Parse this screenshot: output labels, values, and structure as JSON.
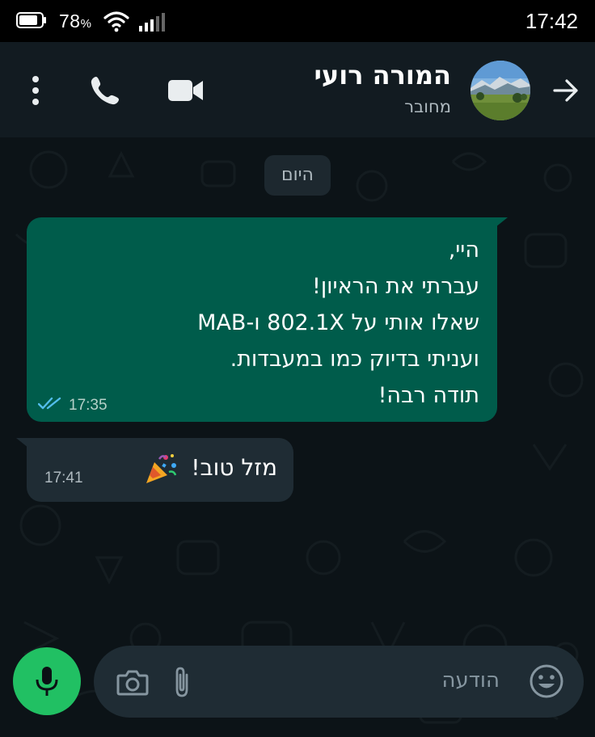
{
  "status_bar": {
    "battery_percent": "78",
    "battery_unit": "%",
    "time": "17:42"
  },
  "header": {
    "contact_name": "המורה רועי",
    "status": "מחובר"
  },
  "chat": {
    "date_chip": "היום",
    "messages": [
      {
        "direction": "outgoing",
        "text": "היי,\nעברתי את הראיון!\nשאלו אותי על 802.1X ו-MAB\nועניתי בדיוק כמו במעבדות.\nתודה רבה!",
        "time": "17:35",
        "status": "read"
      },
      {
        "direction": "incoming",
        "text": "מזל טוב!",
        "emoji": "party-popper",
        "time": "17:41"
      }
    ]
  },
  "composer": {
    "placeholder": "הודעה"
  },
  "colors": {
    "outgoing_bubble": "#005c4b",
    "incoming_bubble": "#1f2c34",
    "header": "#121b21",
    "mic_button": "#21c063",
    "read_ticks": "#53bdeb"
  },
  "icons": [
    "battery-icon",
    "wifi-icon",
    "signal-icon",
    "back-arrow-icon",
    "video-call-icon",
    "phone-icon",
    "more-vert-icon",
    "double-check-icon",
    "party-popper-icon",
    "mic-icon",
    "emoji-icon",
    "attach-icon",
    "camera-icon"
  ]
}
